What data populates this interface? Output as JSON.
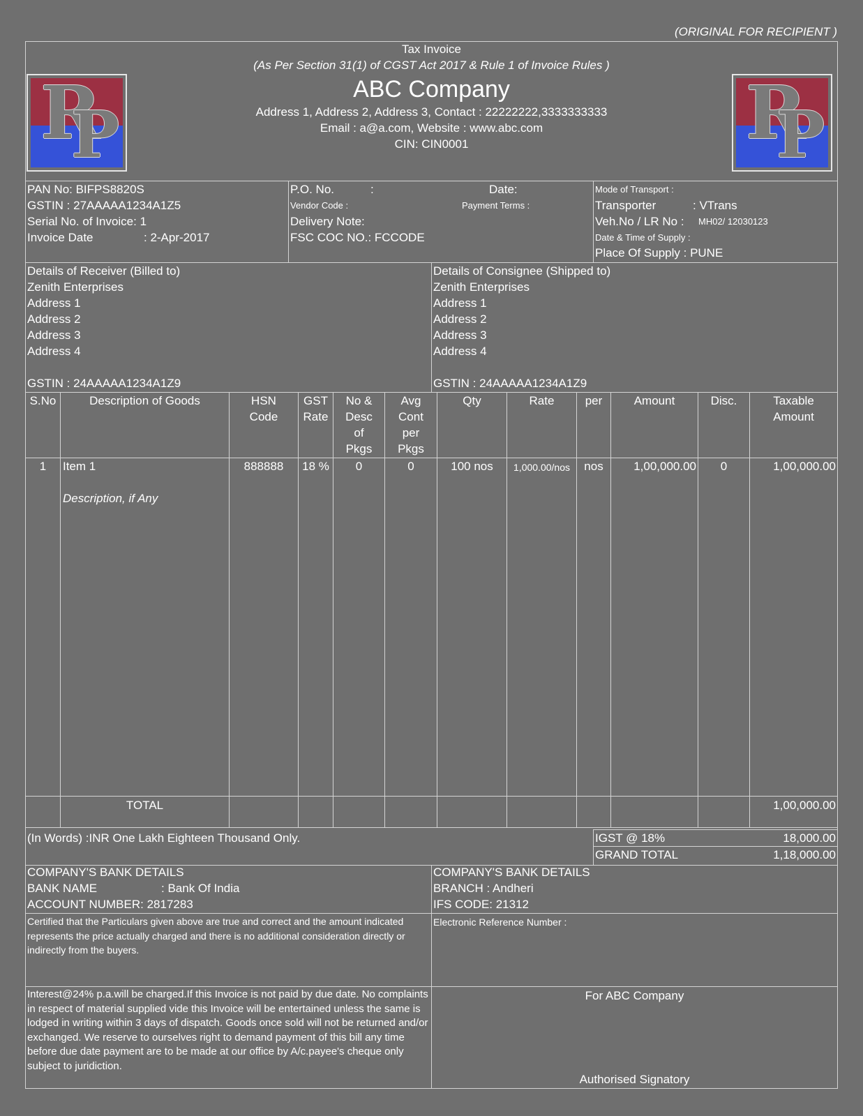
{
  "copy_label": "(ORIGINAL FOR RECIPIENT )",
  "header": {
    "title": "Tax Invoice",
    "subtitle": "(As Per Section 31(1) of CGST Act 2017 & Rule 1 of Invoice Rules )",
    "company_name": "ABC Company",
    "address_line": "Address 1, Address 2, Address 3, Contact : 22222222,3333333333",
    "email_line": "Email : a@a.com, Website : www.abc.com",
    "cin_line": "CIN: CIN0001",
    "logo_text": "RP"
  },
  "info": {
    "pan": "PAN No: BIFPS8820S",
    "gstin": "GSTIN : 27AAAAA1234A1Z5",
    "serial": "Serial No. of Invoice: 1",
    "invoice_date_label": "Invoice Date",
    "invoice_date_value": ": 2-Apr-2017",
    "po_no": "P.O. No.",
    "po_colon": ":",
    "date": "Date:",
    "vendor_code": "Vendor Code :",
    "payment_terms": "Payment Terms :",
    "delivery_note": "Delivery Note:",
    "fsc_coc": "FSC COC NO.: FCCODE",
    "mode_of_transport": "Mode of Transport :",
    "transporter_label": "Transporter",
    "transporter_value": ": VTrans",
    "veh_label": "Veh.No / LR No :",
    "veh_value": "MH02/ 12030123",
    "date_time_supply": "Date & Time of Supply :",
    "place_of_supply": "Place Of Supply : PUNE"
  },
  "receiver": {
    "heading": "Details of Receiver (Billed to)",
    "name": "Zenith Enterprises",
    "address": [
      "Address 1",
      "Address 2",
      "Address 3",
      "Address 4"
    ],
    "gstin": "GSTIN : 24AAAAA1234A1Z9"
  },
  "consignee": {
    "heading": "Details of Consignee (Shipped to)",
    "name": "Zenith Enterprises",
    "address": [
      "Address 1",
      "Address 2",
      "Address 3",
      "Address 4"
    ],
    "gstin": "GSTIN : 24AAAAA1234A1Z9"
  },
  "table": {
    "columns": {
      "sno": [
        "S.No"
      ],
      "desc": [
        "Description of Goods"
      ],
      "hsn": [
        "HSN",
        "Code"
      ],
      "gst": [
        "GST",
        "Rate"
      ],
      "pkgs": [
        "No &",
        "Desc",
        "of",
        "Pkgs"
      ],
      "avg": [
        "Avg",
        "Cont",
        "per",
        "Pkgs"
      ],
      "qty": [
        "Qty"
      ],
      "rate": [
        "Rate"
      ],
      "per": [
        "per"
      ],
      "amount": [
        "Amount"
      ],
      "disc": [
        "Disc."
      ],
      "taxable": [
        "Taxable",
        "Amount"
      ]
    },
    "rows": [
      {
        "sno": "1",
        "item": "Item 1",
        "description": "Description, if Any",
        "hsn": "888888",
        "gst": "18 %",
        "pkgs": "0",
        "avg": "0",
        "qty": "100 nos",
        "rate": "1,000.00/nos",
        "per": "nos",
        "amount": "1,00,000.00",
        "disc": "0",
        "taxable": "1,00,000.00"
      }
    ],
    "total_label": "TOTAL",
    "total_value": "1,00,000.00"
  },
  "summary": {
    "in_words": "(In Words) :INR One Lakh Eighteen Thousand Only.",
    "igst_label": "IGST @ 18%",
    "igst_value": "18,000.00",
    "grand_total_label": "GRAND TOTAL",
    "grand_total_value": "1,18,000.00"
  },
  "bank": {
    "heading_left": "COMPANY'S BANK DETAILS",
    "bank_name_label": "BANK NAME",
    "bank_name_value": ": Bank Of India",
    "account": "ACCOUNT NUMBER: 2817283",
    "heading_right": "COMPANY'S BANK DETAILS",
    "branch": "BRANCH : Andheri",
    "ifs": "IFS CODE: 21312"
  },
  "certification": "Certified that the Particulars given above are true and correct and the amount indicated represents the price actually charged and there is no additional consideration directly or indirectly from the buyers.",
  "electronic_ref": "Electronic Reference Number   :",
  "terms": "Interest@24% p.a.will be charged.If this Invoice is not paid by due date. No complaints in respect of material supplied vide this Invoice will be entertained unless the same is lodged in writing within 3 days of dispatch. Goods once sold will not be returned and/or exchanged. We reserve to ourselves right to demand payment of this bill any time before due date payment are to be made at our office by A/c.payee's cheque only subject to juridiction.",
  "signature": {
    "for_company": "For ABC Company",
    "signatory": "Authorised Signatory"
  }
}
